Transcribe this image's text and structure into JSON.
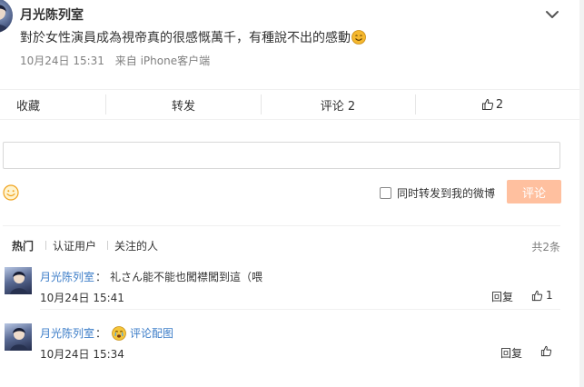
{
  "post": {
    "author": "月光陈列室",
    "text": "對於女性演員成為視帝真的很感慨萬千，有種說不出的感動",
    "time": "10月24日 15:31",
    "source": "来自 iPhone客户端"
  },
  "actions": {
    "favorite_label": "收藏",
    "repost_label": "转发",
    "comment_label": "评论 2",
    "like_count": "2"
  },
  "composer": {
    "input_value": "",
    "repost_option_label": "同时转发到我的微博",
    "repost_checked": false,
    "submit_label": "评论"
  },
  "filters": {
    "tabs": [
      {
        "label": "热门",
        "active": true
      },
      {
        "label": "认证用户",
        "active": false
      },
      {
        "label": "关注的人",
        "active": false
      }
    ],
    "total_label": "共2条"
  },
  "comments": [
    {
      "author": "月光陈列室",
      "text": "礼さん能不能也闖襟闖到這（喂",
      "time": "10月24日 15:41",
      "reply_label": "回复",
      "like_count": "1"
    },
    {
      "author": "月光陈列室",
      "image_link_label": "评论配图",
      "time": "10月24日 15:34",
      "reply_label": "回复",
      "like_count": ""
    }
  ],
  "icons": {
    "post_menu": "chevron-down-icon",
    "emoji_in_text": "smile-emoji-icon",
    "like": "thumbs-up-icon",
    "composer_emoji": "smiley-face-icon",
    "comment_face": "crying-face-emoji-icon"
  },
  "colors": {
    "link_blue": "#3c7dc8",
    "submit_disabled": "#ffc09f",
    "emoji_yellow": "#f5b82e",
    "text": "#333333",
    "meta_gray": "#808080"
  }
}
